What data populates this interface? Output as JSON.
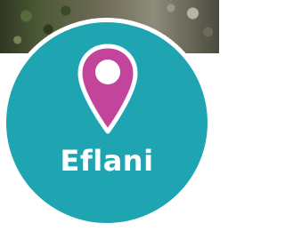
{
  "badge": {
    "place_name": "Eflani",
    "icon": "map-pin-icon",
    "colors": {
      "circle": "#1fa5b2",
      "pin": "#c2459b",
      "text": "#ffffff",
      "border": "#ffffff"
    }
  }
}
